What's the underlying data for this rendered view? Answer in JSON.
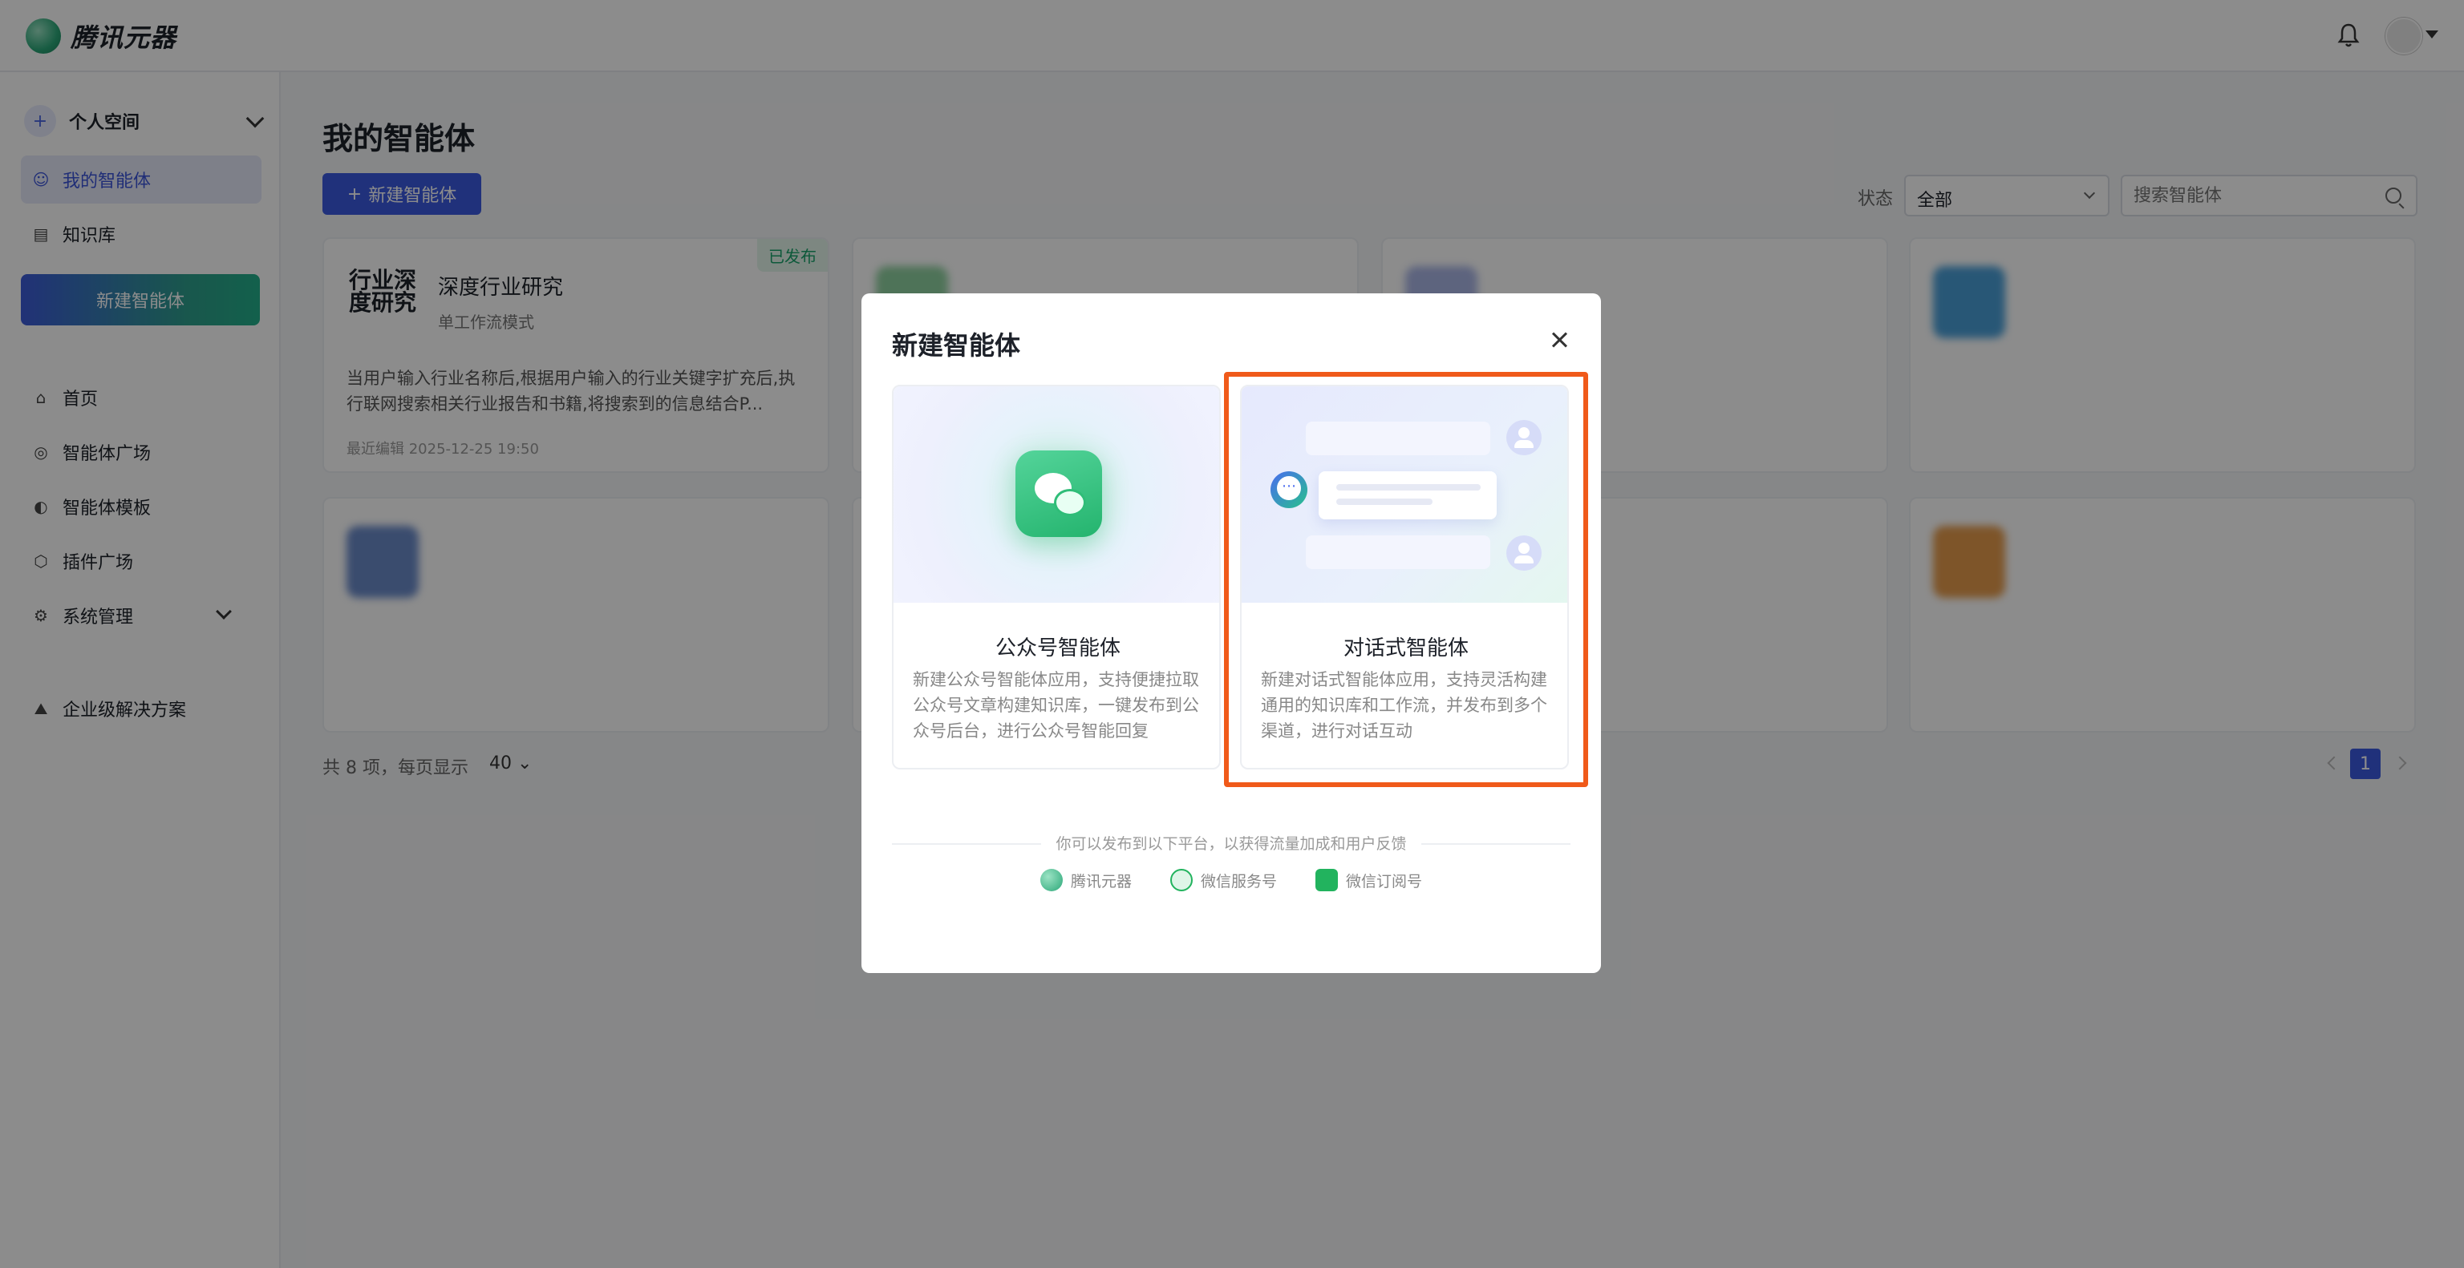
{
  "app": {
    "logo_text": "腾讯元器"
  },
  "sidebar": {
    "space_label": "个人空间",
    "items": [
      {
        "label": "我的智能体",
        "icon": "robot-icon",
        "active": true
      },
      {
        "label": "知识库",
        "icon": "document-icon"
      }
    ],
    "new_agent_label": "新建智能体",
    "nav": [
      {
        "label": "首页",
        "icon": "home-icon"
      },
      {
        "label": "智能体广场",
        "icon": "agent-plaza-icon"
      },
      {
        "label": "智能体模板",
        "icon": "template-icon"
      },
      {
        "label": "插件广场",
        "icon": "plugin-icon"
      },
      {
        "label": "系统管理",
        "icon": "settings-icon"
      },
      {
        "label": "企业级解决方案",
        "icon": "enterprise-icon"
      }
    ]
  },
  "main": {
    "title": "我的智能体",
    "new_button": "新建智能体",
    "status_label": "状态",
    "status_value": "全部",
    "search_placeholder": "搜索智能体",
    "cards": [
      {
        "name": "深度行业研究",
        "thumb_text": "行业深度研究",
        "mode": "单工作流模式",
        "desc": "当用户输入行业名称后,根据用户输入的行业关键字扩充后,执行联网搜索相关行业报告和书籍,将搜索到的信息结合P...",
        "time": "最近编辑 2025-12-25 19:50",
        "badge": "已发布"
      }
    ],
    "pager": {
      "summary": "共 8 项，每页显示",
      "page_size": "40",
      "current_page": "1"
    }
  },
  "modal": {
    "title": "新建智能体",
    "options": [
      {
        "title": "公众号智能体",
        "desc": "新建公众号智能体应用，支持便捷拉取公众号文章构建知识库，一键发布到公众号后台，进行公众号智能回复"
      },
      {
        "title": "对话式智能体",
        "desc": "新建对话式智能体应用，支持灵活构建通用的知识库和工作流，并发布到多个渠道，进行对话互动"
      }
    ],
    "publish_hint": "你可以发布到以下平台，以获得流量加成和用户反馈",
    "platforms": [
      {
        "label": "腾讯元器",
        "color": "#2ba778"
      },
      {
        "label": "微信服务号",
        "color": "#22b35e"
      },
      {
        "label": "微信订阅号",
        "color": "#22b35e"
      }
    ]
  },
  "colors": {
    "primary": "#3b5ae0",
    "highlight": "#f05a1a",
    "published": "#19a36a"
  }
}
